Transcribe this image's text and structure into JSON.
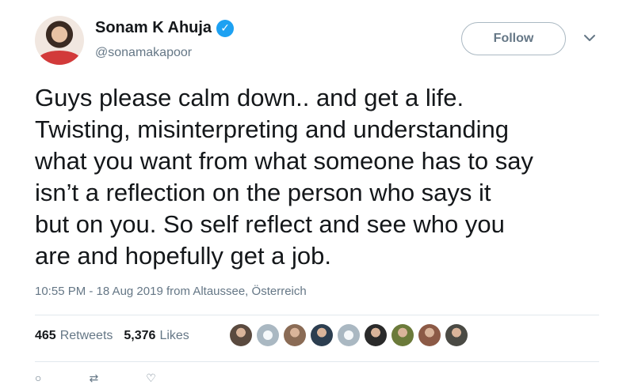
{
  "user": {
    "display_name": "Sonam K Ahuja",
    "handle": "@sonamakapoor",
    "verified_icon": "✓"
  },
  "follow_label": "Follow",
  "tweet": {
    "lines": [
      "Guys please calm down.. and get a life.",
      "Twisting, misinterpreting and understanding",
      "what you want from what someone has to say",
      "isn’t a reflection on the person who says it",
      "but on you. So self reflect and see who you",
      "are and hopefully get a job."
    ]
  },
  "meta": {
    "timestamp": "10:55 PM - 18 Aug 2019",
    "from_word": "from",
    "location": "Altaussee, Österreich"
  },
  "stats": {
    "retweets_count": "465",
    "retweets_label": "Retweets",
    "likes_count": "5,376",
    "likes_label": "Likes"
  },
  "likers": [
    {
      "kind": "photo",
      "color": "#5a4a3f"
    },
    {
      "kind": "default",
      "color": "#aab8c2"
    },
    {
      "kind": "photo",
      "color": "#8a6b55"
    },
    {
      "kind": "photo",
      "color": "#2c3e50"
    },
    {
      "kind": "default",
      "color": "#aab8c2"
    },
    {
      "kind": "photo",
      "color": "#2a2a2a"
    },
    {
      "kind": "photo",
      "color": "#6b7a3a"
    },
    {
      "kind": "photo",
      "color": "#8c5a46"
    },
    {
      "kind": "photo",
      "color": "#4a4a44"
    }
  ],
  "colors": {
    "accent": "#1da1f2",
    "secondary_text": "#657786"
  }
}
